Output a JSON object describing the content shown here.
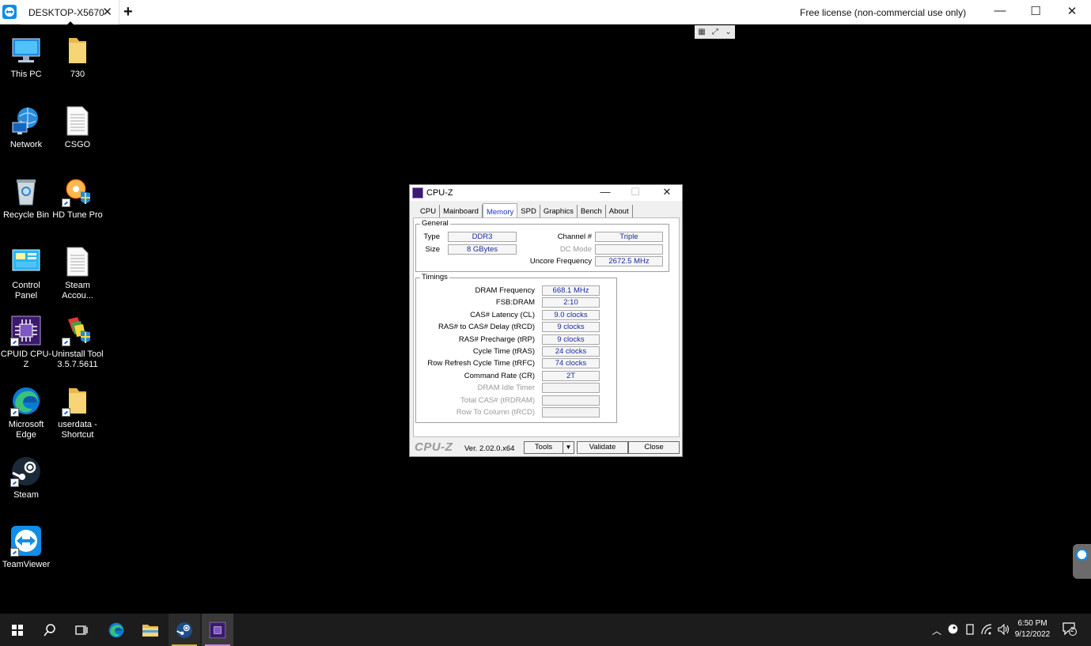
{
  "teamviewer": {
    "tab_label": "DESKTOP-X5670",
    "close_glyph": "✕",
    "add_glyph": "+",
    "license": "Free license (non-commercial use only)",
    "minimize_glyph": "—",
    "maximize_glyph": "☐",
    "close_window_glyph": "✕",
    "brand_color": "#0e8ee9"
  },
  "desktop": {
    "icons": [
      {
        "label": "This PC",
        "icon": "computer-icon"
      },
      {
        "label": "730",
        "icon": "folder-icon"
      },
      {
        "label": "Network",
        "icon": "network-icon"
      },
      {
        "label": "CSGO",
        "icon": "document-icon"
      },
      {
        "label": "Recycle Bin",
        "icon": "recycle-bin-icon"
      },
      {
        "label": "HD Tune Pro",
        "icon": "hdtune-icon"
      },
      {
        "label": "Control Panel",
        "icon": "control-panel-icon"
      },
      {
        "label": "Steam Accou...",
        "icon": "document-icon"
      },
      {
        "label": "CPUID CPU-Z",
        "icon": "cpuz-icon"
      },
      {
        "label": "Uninstall Tool 3.5.7.5611",
        "icon": "uninstall-tool-icon"
      },
      {
        "label": "Microsoft Edge",
        "icon": "edge-icon"
      },
      {
        "label": "userdata - Shortcut",
        "icon": "folder-icon"
      },
      {
        "label": "Steam",
        "icon": "steam-icon"
      },
      {
        "label": "TeamViewer",
        "icon": "teamviewer-icon"
      }
    ]
  },
  "cpuz": {
    "title": "CPU-Z",
    "tabs": [
      "CPU",
      "Mainboard",
      "Memory",
      "SPD",
      "Graphics",
      "Bench",
      "About"
    ],
    "active_tab": "Memory",
    "general": {
      "title": "General",
      "type_label": "Type",
      "type_value": "DDR3",
      "size_label": "Size",
      "size_value": "8 GBytes",
      "channel_label": "Channel #",
      "channel_value": "Triple",
      "dcmode_label": "DC Mode",
      "dcmode_value": "",
      "uncore_label": "Uncore Frequency",
      "uncore_value": "2672.5 MHz"
    },
    "timings": {
      "title": "Timings",
      "rows": [
        {
          "label": "DRAM Frequency",
          "value": "668.1 MHz",
          "enabled": true
        },
        {
          "label": "FSB:DRAM",
          "value": "2:10",
          "enabled": true
        },
        {
          "label": "CAS# Latency (CL)",
          "value": "9.0 clocks",
          "enabled": true
        },
        {
          "label": "RAS# to CAS# Delay (tRCD)",
          "value": "9 clocks",
          "enabled": true
        },
        {
          "label": "RAS# Precharge (tRP)",
          "value": "9 clocks",
          "enabled": true
        },
        {
          "label": "Cycle Time (tRAS)",
          "value": "24 clocks",
          "enabled": true
        },
        {
          "label": "Row Refresh Cycle Time (tRFC)",
          "value": "74 clocks",
          "enabled": true
        },
        {
          "label": "Command Rate (CR)",
          "value": "2T",
          "enabled": true
        },
        {
          "label": "DRAM Idle Timer",
          "value": "",
          "enabled": false
        },
        {
          "label": "Total CAS# (tRDRAM)",
          "value": "",
          "enabled": false
        },
        {
          "label": "Row To Column (tRCD)",
          "value": "",
          "enabled": false
        }
      ]
    },
    "footer": {
      "brand": "CPU-Z",
      "version": "Ver. 2.02.0.x64",
      "tools": "Tools",
      "validate": "Validate",
      "close": "Close"
    }
  },
  "taskbar": {
    "clock_time": "6:50 PM",
    "clock_date": "9/12/2022",
    "notification_count": "2",
    "running_accent": "#c9b437"
  }
}
